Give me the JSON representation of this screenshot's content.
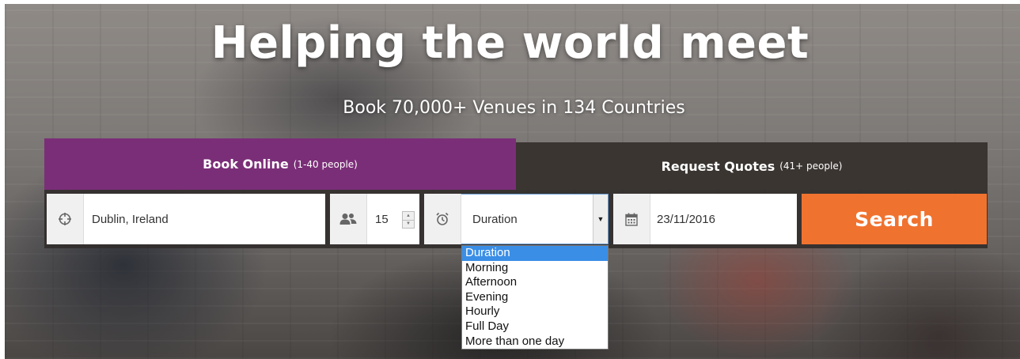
{
  "hero": {
    "title": "Helping the world meet",
    "subtitle": "Book 70,000+ Venues in 134 Countries"
  },
  "tabs": [
    {
      "label": "Book Online",
      "note": "(1-40 people)",
      "active": true
    },
    {
      "label": "Request Quotes",
      "note": "(41+ people)",
      "active": false
    }
  ],
  "form": {
    "location": {
      "value": "Dublin, Ireland",
      "icon": "crosshair-icon"
    },
    "people": {
      "value": "15",
      "icon": "people-icon"
    },
    "duration": {
      "value": "Duration",
      "icon": "alarm-clock-icon",
      "options": [
        "Duration",
        "Morning",
        "Afternoon",
        "Evening",
        "Hourly",
        "Full Day",
        "More than one day"
      ],
      "selected_index": 0
    },
    "date": {
      "value": "23/11/2016",
      "icon": "calendar-icon"
    },
    "search_label": "Search"
  },
  "colors": {
    "book_tab": "#7b2e78",
    "quote_tab": "#3a3531",
    "search_button": "#f0722f",
    "dropdown_highlight": "#3a8ee6"
  }
}
